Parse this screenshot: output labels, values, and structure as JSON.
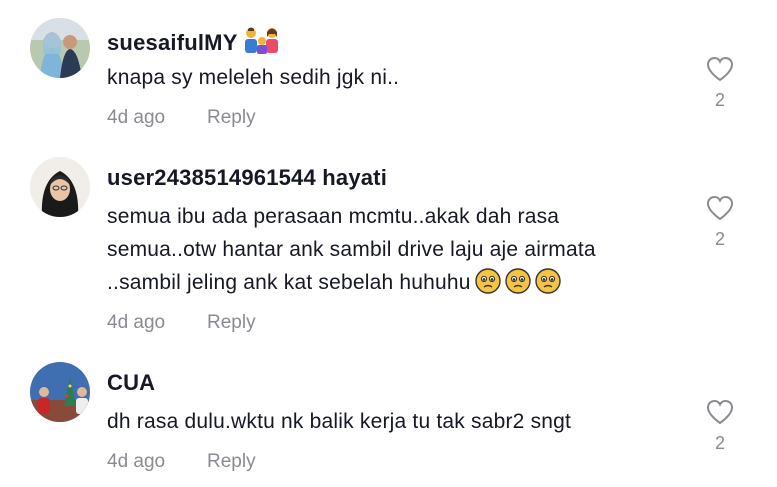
{
  "comments": [
    {
      "username": "suesaifulMY",
      "username_suffix_badge": "family-emoji",
      "text": "knapa sy meleleh sedih jgk ni..",
      "time": "4d ago",
      "reply_label": "Reply",
      "likes": "2"
    },
    {
      "username": "user2438514961544 hayati",
      "text": "semua ibu ada perasaan mcmtu..akak dah rasa semua..otw hantar ank sambil drive laju aje airmata ..sambil jeling ank kat sebelah huhuhu",
      "trailing_emojis": [
        "pleading-face",
        "pleading-face",
        "pleading-face"
      ],
      "time": "4d ago",
      "reply_label": "Reply",
      "likes": "2"
    },
    {
      "username": "CUA",
      "text": "dh rasa dulu.wktu nk balik kerja tu tak sabr2 sngt",
      "time": "4d ago",
      "reply_label": "Reply",
      "likes": "2"
    }
  ],
  "icons": {
    "like": "heart-outline-icon"
  },
  "colors": {
    "text": "#161823",
    "muted": "#8a8b91"
  }
}
